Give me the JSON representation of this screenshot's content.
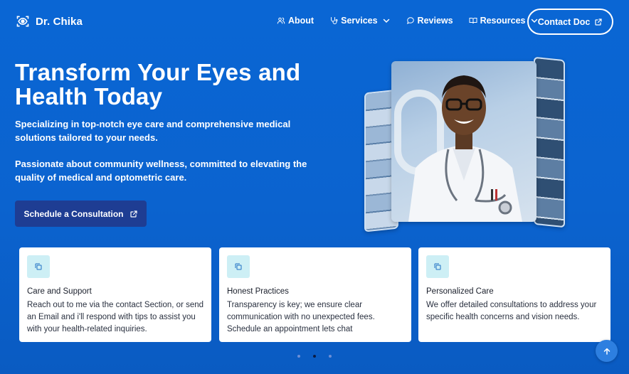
{
  "brand": {
    "name": "Dr. Chika",
    "icon": "eye-scan-icon"
  },
  "nav": {
    "items": [
      {
        "label": "About",
        "icon": "users-icon",
        "has_dropdown": false
      },
      {
        "label": "Services",
        "icon": "stethoscope-icon",
        "has_dropdown": true
      },
      {
        "label": "Reviews",
        "icon": "chat-bubble-icon",
        "has_dropdown": false
      },
      {
        "label": "Resources",
        "icon": "book-open-icon",
        "has_dropdown": true
      }
    ],
    "contact_label": "Contact Doc"
  },
  "hero": {
    "title": "Transform Your Eyes and Health Today",
    "paragraph_1": "Specializing in top-notch eye care and comprehensive medical solutions tailored to your needs.",
    "paragraph_2": "Passionate about community wellness, committed to elevating the quality of medical and optometric care.",
    "cta_label": "Schedule a Consultation"
  },
  "cards": [
    {
      "title": "Care and Support",
      "body": "Reach out to me via the contact Section, or send an Email and i'll respond with tips to assist you with your health-related inquiries.",
      "icon": "copy-icon"
    },
    {
      "title": "Honest Practices",
      "body": "Transparency is key; we ensure clear communication with no unexpected fees. Schedule an appointment lets chat",
      "icon": "copy-icon"
    },
    {
      "title": "Personalized Care",
      "body": "We offer detailed consultations to address your specific health concerns and vision needs.",
      "icon": "copy-icon"
    }
  ],
  "carousel": {
    "dot_count": 3,
    "active_index": 1
  },
  "colors": {
    "background": "#0a66d4",
    "cta": "#1e3d93",
    "card_icon_bg": "#cdeff5",
    "scroll_top": "#2d7fe0"
  }
}
